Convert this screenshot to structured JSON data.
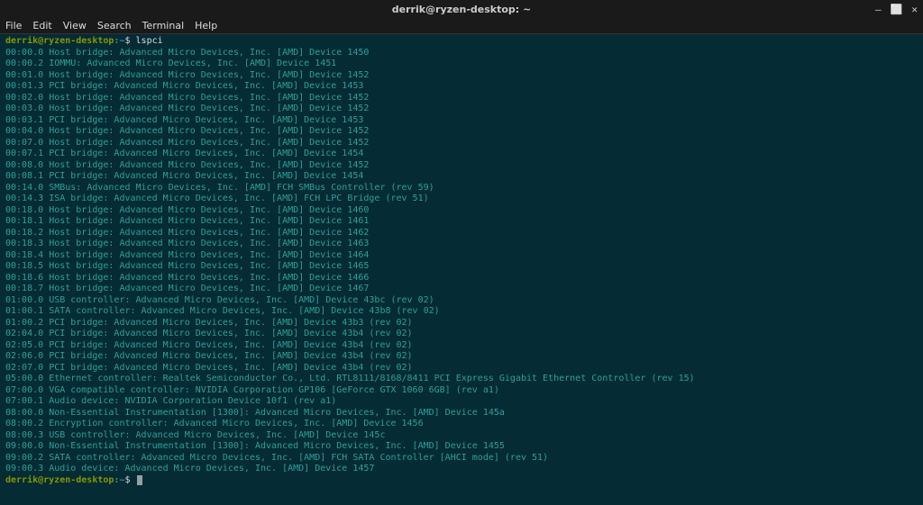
{
  "window": {
    "title": "derrik@ryzen-desktop: ~",
    "controls": {
      "minimize": "–",
      "maximize": "⬜",
      "close": "✕"
    }
  },
  "menu": {
    "items": [
      "File",
      "Edit",
      "View",
      "Search",
      "Terminal",
      "Help"
    ]
  },
  "prompt": {
    "user_host": "derrik@ryzen-desktop",
    "separator": ":",
    "path": "~",
    "symbol": "$"
  },
  "command": "lspci",
  "output_lines": [
    {
      "addr": "00:00.0",
      "desc": "Host bridge: Advanced Micro Devices, Inc. [AMD] Device 1450"
    },
    {
      "addr": "00:00.2",
      "desc": "IOMMU: Advanced Micro Devices, Inc. [AMD] Device 1451"
    },
    {
      "addr": "00:01.0",
      "desc": "Host bridge: Advanced Micro Devices, Inc. [AMD] Device 1452"
    },
    {
      "addr": "00:01.3",
      "desc": "PCI bridge: Advanced Micro Devices, Inc. [AMD] Device 1453"
    },
    {
      "addr": "00:02.0",
      "desc": "Host bridge: Advanced Micro Devices, Inc. [AMD] Device 1452"
    },
    {
      "addr": "00:03.0",
      "desc": "Host bridge: Advanced Micro Devices, Inc. [AMD] Device 1452"
    },
    {
      "addr": "00:03.1",
      "desc": "PCI bridge: Advanced Micro Devices, Inc. [AMD] Device 1453"
    },
    {
      "addr": "00:04.0",
      "desc": "Host bridge: Advanced Micro Devices, Inc. [AMD] Device 1452"
    },
    {
      "addr": "00:07.0",
      "desc": "Host bridge: Advanced Micro Devices, Inc. [AMD] Device 1452"
    },
    {
      "addr": "00:07.1",
      "desc": "PCI bridge: Advanced Micro Devices, Inc. [AMD] Device 1454"
    },
    {
      "addr": "00:08.0",
      "desc": "Host bridge: Advanced Micro Devices, Inc. [AMD] Device 1452"
    },
    {
      "addr": "00:08.1",
      "desc": "PCI bridge: Advanced Micro Devices, Inc. [AMD] Device 1454"
    },
    {
      "addr": "00:14.0",
      "desc": "SMBus: Advanced Micro Devices, Inc. [AMD] FCH SMBus Controller (rev 59)"
    },
    {
      "addr": "00:14.3",
      "desc": "ISA bridge: Advanced Micro Devices, Inc. [AMD] FCH LPC Bridge (rev 51)"
    },
    {
      "addr": "00:18.0",
      "desc": "Host bridge: Advanced Micro Devices, Inc. [AMD] Device 1460"
    },
    {
      "addr": "00:18.1",
      "desc": "Host bridge: Advanced Micro Devices, Inc. [AMD] Device 1461"
    },
    {
      "addr": "00:18.2",
      "desc": "Host bridge: Advanced Micro Devices, Inc. [AMD] Device 1462"
    },
    {
      "addr": "00:18.3",
      "desc": "Host bridge: Advanced Micro Devices, Inc. [AMD] Device 1463"
    },
    {
      "addr": "00:18.4",
      "desc": "Host bridge: Advanced Micro Devices, Inc. [AMD] Device 1464"
    },
    {
      "addr": "00:18.5",
      "desc": "Host bridge: Advanced Micro Devices, Inc. [AMD] Device 1465"
    },
    {
      "addr": "00:18.6",
      "desc": "Host bridge: Advanced Micro Devices, Inc. [AMD] Device 1466"
    },
    {
      "addr": "00:18.7",
      "desc": "Host bridge: Advanced Micro Devices, Inc. [AMD] Device 1467"
    },
    {
      "addr": "01:00.0",
      "desc": "USB controller: Advanced Micro Devices, Inc. [AMD] Device 43bc (rev 02)"
    },
    {
      "addr": "01:00.1",
      "desc": "SATA controller: Advanced Micro Devices, Inc. [AMD] Device 43b8 (rev 02)"
    },
    {
      "addr": "01:00.2",
      "desc": "PCI bridge: Advanced Micro Devices, Inc. [AMD] Device 43b3 (rev 02)"
    },
    {
      "addr": "02:04.0",
      "desc": "PCI bridge: Advanced Micro Devices, Inc. [AMD] Device 43b4 (rev 02)"
    },
    {
      "addr": "02:05.0",
      "desc": "PCI bridge: Advanced Micro Devices, Inc. [AMD] Device 43b4 (rev 02)"
    },
    {
      "addr": "02:06.0",
      "desc": "PCI bridge: Advanced Micro Devices, Inc. [AMD] Device 43b4 (rev 02)"
    },
    {
      "addr": "02:07.0",
      "desc": "PCI bridge: Advanced Micro Devices, Inc. [AMD] Device 43b4 (rev 02)"
    },
    {
      "addr": "05:00.0",
      "desc": "Ethernet controller: Realtek Semiconductor Co., Ltd. RTL8111/8168/8411 PCI Express Gigabit Ethernet Controller (rev 15)"
    },
    {
      "addr": "07:00.0",
      "desc": "VGA compatible controller: NVIDIA Corporation GP106 [GeForce GTX 1060 6GB] (rev a1)"
    },
    {
      "addr": "07:00.1",
      "desc": "Audio device: NVIDIA Corporation Device 10f1 (rev a1)"
    },
    {
      "addr": "08:00.0",
      "desc": "Non-Essential Instrumentation [1300]: Advanced Micro Devices, Inc. [AMD] Device 145a"
    },
    {
      "addr": "08:00.2",
      "desc": "Encryption controller: Advanced Micro Devices, Inc. [AMD] Device 1456"
    },
    {
      "addr": "08:00.3",
      "desc": "USB controller: Advanced Micro Devices, Inc. [AMD] Device 145c"
    },
    {
      "addr": "09:00.0",
      "desc": "Non-Essential Instrumentation [1300]: Advanced Micro Devices, Inc. [AMD] Device 1455"
    },
    {
      "addr": "09:00.2",
      "desc": "SATA controller: Advanced Micro Devices, Inc. [AMD] FCH SATA Controller [AHCI mode] (rev 51)"
    },
    {
      "addr": "09:00.3",
      "desc": "Audio device: Advanced Micro Devices, Inc. [AMD] Device 1457"
    }
  ]
}
